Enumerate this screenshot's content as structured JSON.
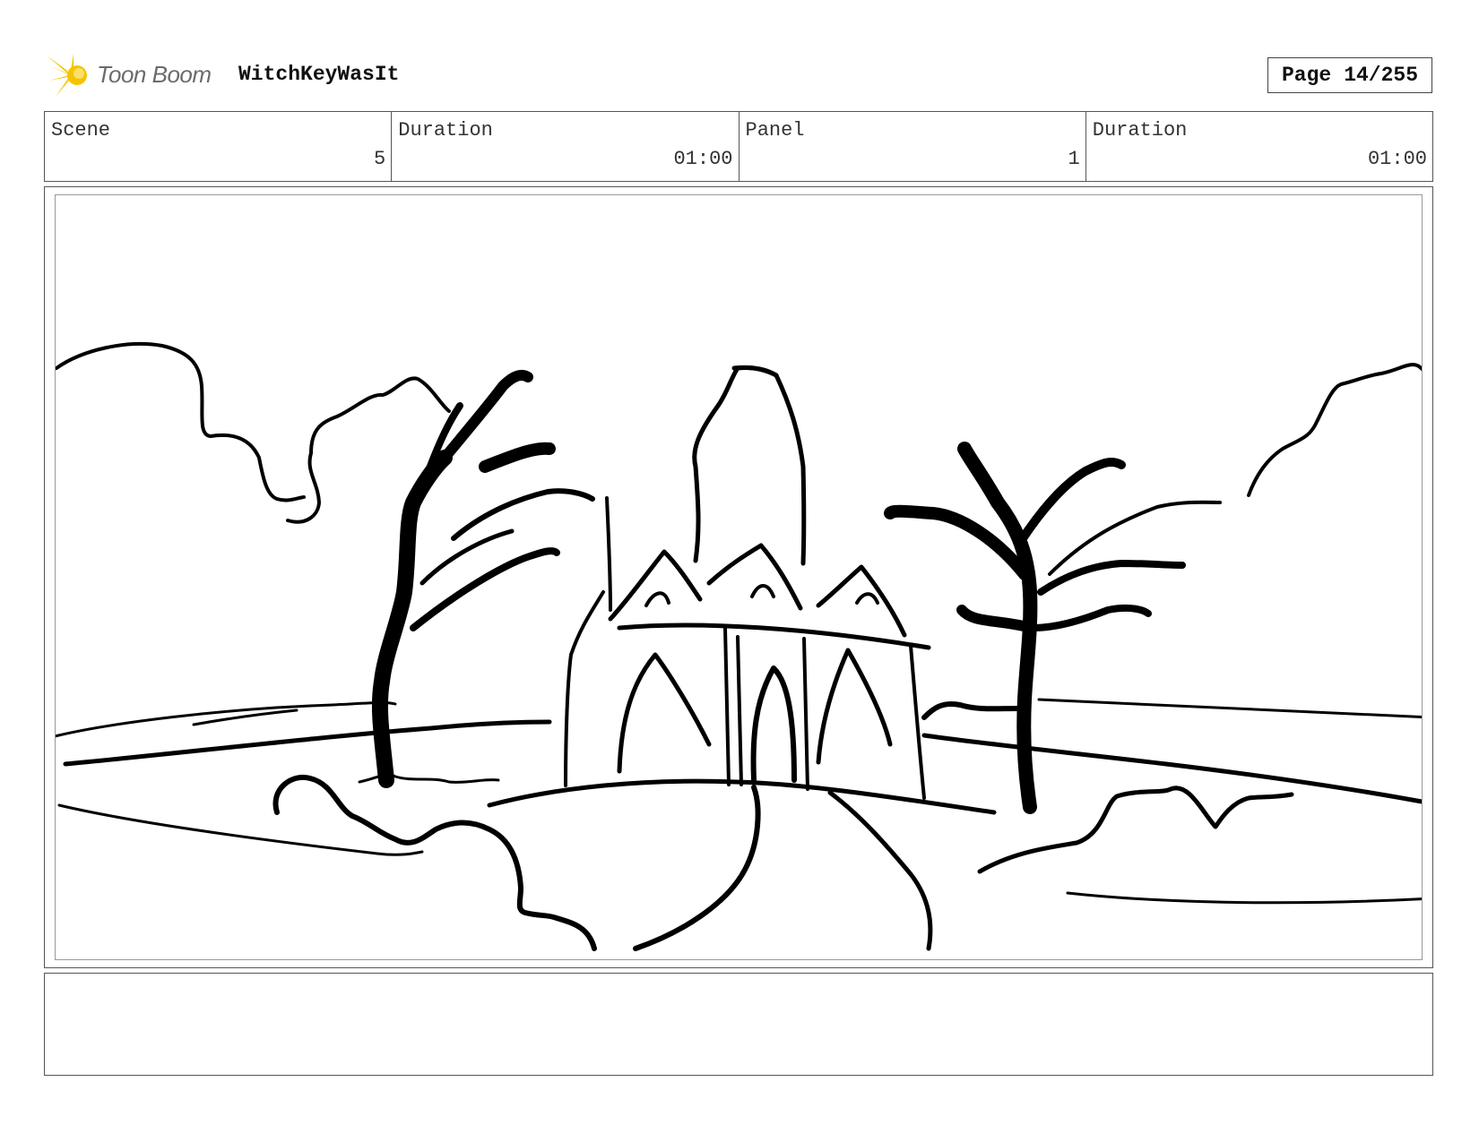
{
  "header": {
    "logo_text": "Toon Boom",
    "project_title": "WitchKeyWasIt",
    "page_label": "Page",
    "page_number": "14/255"
  },
  "info": {
    "scene_label": "Scene",
    "scene_value": "5",
    "scene_duration_label": "Duration",
    "scene_duration_value": "01:00",
    "panel_label": "Panel",
    "panel_value": "1",
    "panel_duration_label": "Duration",
    "panel_duration_value": "01:00"
  },
  "colors": {
    "logo_accent": "#f5c400",
    "logo_text": "#6b6b6b",
    "border": "#555555"
  },
  "icons": {
    "logo": "toon-boom-starburst-icon"
  },
  "notes": {
    "text": ""
  }
}
